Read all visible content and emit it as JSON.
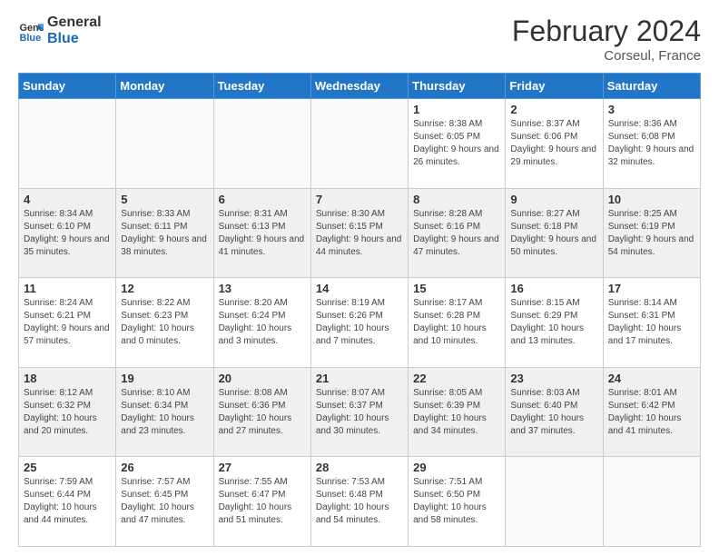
{
  "logo": {
    "line1": "General",
    "line2": "Blue"
  },
  "title": "February 2024",
  "subtitle": "Corseul, France",
  "days_of_week": [
    "Sunday",
    "Monday",
    "Tuesday",
    "Wednesday",
    "Thursday",
    "Friday",
    "Saturday"
  ],
  "weeks": [
    [
      {
        "day": "",
        "info": ""
      },
      {
        "day": "",
        "info": ""
      },
      {
        "day": "",
        "info": ""
      },
      {
        "day": "",
        "info": ""
      },
      {
        "day": "1",
        "info": "Sunrise: 8:38 AM\nSunset: 6:05 PM\nDaylight: 9 hours and 26 minutes."
      },
      {
        "day": "2",
        "info": "Sunrise: 8:37 AM\nSunset: 6:06 PM\nDaylight: 9 hours and 29 minutes."
      },
      {
        "day": "3",
        "info": "Sunrise: 8:36 AM\nSunset: 6:08 PM\nDaylight: 9 hours and 32 minutes."
      }
    ],
    [
      {
        "day": "4",
        "info": "Sunrise: 8:34 AM\nSunset: 6:10 PM\nDaylight: 9 hours and 35 minutes."
      },
      {
        "day": "5",
        "info": "Sunrise: 8:33 AM\nSunset: 6:11 PM\nDaylight: 9 hours and 38 minutes."
      },
      {
        "day": "6",
        "info": "Sunrise: 8:31 AM\nSunset: 6:13 PM\nDaylight: 9 hours and 41 minutes."
      },
      {
        "day": "7",
        "info": "Sunrise: 8:30 AM\nSunset: 6:15 PM\nDaylight: 9 hours and 44 minutes."
      },
      {
        "day": "8",
        "info": "Sunrise: 8:28 AM\nSunset: 6:16 PM\nDaylight: 9 hours and 47 minutes."
      },
      {
        "day": "9",
        "info": "Sunrise: 8:27 AM\nSunset: 6:18 PM\nDaylight: 9 hours and 50 minutes."
      },
      {
        "day": "10",
        "info": "Sunrise: 8:25 AM\nSunset: 6:19 PM\nDaylight: 9 hours and 54 minutes."
      }
    ],
    [
      {
        "day": "11",
        "info": "Sunrise: 8:24 AM\nSunset: 6:21 PM\nDaylight: 9 hours and 57 minutes."
      },
      {
        "day": "12",
        "info": "Sunrise: 8:22 AM\nSunset: 6:23 PM\nDaylight: 10 hours and 0 minutes."
      },
      {
        "day": "13",
        "info": "Sunrise: 8:20 AM\nSunset: 6:24 PM\nDaylight: 10 hours and 3 minutes."
      },
      {
        "day": "14",
        "info": "Sunrise: 8:19 AM\nSunset: 6:26 PM\nDaylight: 10 hours and 7 minutes."
      },
      {
        "day": "15",
        "info": "Sunrise: 8:17 AM\nSunset: 6:28 PM\nDaylight: 10 hours and 10 minutes."
      },
      {
        "day": "16",
        "info": "Sunrise: 8:15 AM\nSunset: 6:29 PM\nDaylight: 10 hours and 13 minutes."
      },
      {
        "day": "17",
        "info": "Sunrise: 8:14 AM\nSunset: 6:31 PM\nDaylight: 10 hours and 17 minutes."
      }
    ],
    [
      {
        "day": "18",
        "info": "Sunrise: 8:12 AM\nSunset: 6:32 PM\nDaylight: 10 hours and 20 minutes."
      },
      {
        "day": "19",
        "info": "Sunrise: 8:10 AM\nSunset: 6:34 PM\nDaylight: 10 hours and 23 minutes."
      },
      {
        "day": "20",
        "info": "Sunrise: 8:08 AM\nSunset: 6:36 PM\nDaylight: 10 hours and 27 minutes."
      },
      {
        "day": "21",
        "info": "Sunrise: 8:07 AM\nSunset: 6:37 PM\nDaylight: 10 hours and 30 minutes."
      },
      {
        "day": "22",
        "info": "Sunrise: 8:05 AM\nSunset: 6:39 PM\nDaylight: 10 hours and 34 minutes."
      },
      {
        "day": "23",
        "info": "Sunrise: 8:03 AM\nSunset: 6:40 PM\nDaylight: 10 hours and 37 minutes."
      },
      {
        "day": "24",
        "info": "Sunrise: 8:01 AM\nSunset: 6:42 PM\nDaylight: 10 hours and 41 minutes."
      }
    ],
    [
      {
        "day": "25",
        "info": "Sunrise: 7:59 AM\nSunset: 6:44 PM\nDaylight: 10 hours and 44 minutes."
      },
      {
        "day": "26",
        "info": "Sunrise: 7:57 AM\nSunset: 6:45 PM\nDaylight: 10 hours and 47 minutes."
      },
      {
        "day": "27",
        "info": "Sunrise: 7:55 AM\nSunset: 6:47 PM\nDaylight: 10 hours and 51 minutes."
      },
      {
        "day": "28",
        "info": "Sunrise: 7:53 AM\nSunset: 6:48 PM\nDaylight: 10 hours and 54 minutes."
      },
      {
        "day": "29",
        "info": "Sunrise: 7:51 AM\nSunset: 6:50 PM\nDaylight: 10 hours and 58 minutes."
      },
      {
        "day": "",
        "info": ""
      },
      {
        "day": "",
        "info": ""
      }
    ]
  ]
}
